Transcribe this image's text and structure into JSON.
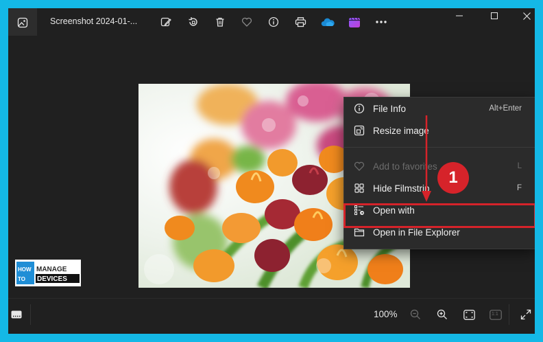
{
  "window": {
    "title": "Screenshot 2024-01-..."
  },
  "toolbar": {
    "icons": [
      "edit-image-icon",
      "rotate-icon",
      "delete-icon",
      "favorite-icon",
      "info-icon",
      "print-icon",
      "onedrive-icon",
      "clipchamp-icon",
      "more-icon"
    ]
  },
  "context_menu": {
    "items": [
      {
        "label": "File Info",
        "shortcut": "Alt+Enter",
        "icon": "info-icon"
      },
      {
        "label": "Resize image",
        "shortcut": "",
        "icon": "resize-icon"
      },
      {
        "label": "Add to favorites",
        "shortcut": "L",
        "icon": "heart-icon",
        "disabled": true
      },
      {
        "label": "Hide Filmstrip",
        "shortcut": "F",
        "icon": "grid-icon"
      },
      {
        "label": "Open with",
        "shortcut": "",
        "icon": "open-with-icon"
      },
      {
        "label": "Open in File Explorer",
        "shortcut": "",
        "icon": "folder-icon"
      }
    ]
  },
  "annotation": {
    "step_number": "1",
    "highlight_color": "#d6232a"
  },
  "logo": {
    "line1_left": "HOW",
    "line1_right": "MANAGE",
    "line2_left": "TO",
    "line2_right": "DEVICES"
  },
  "bottom_bar": {
    "zoom_level": "100%",
    "fit_label": "1:1"
  },
  "colors": {
    "frame": "#14b8e6",
    "window_bg": "#202020",
    "menu_bg": "#2b2b2b",
    "accent": "#d6232a"
  }
}
